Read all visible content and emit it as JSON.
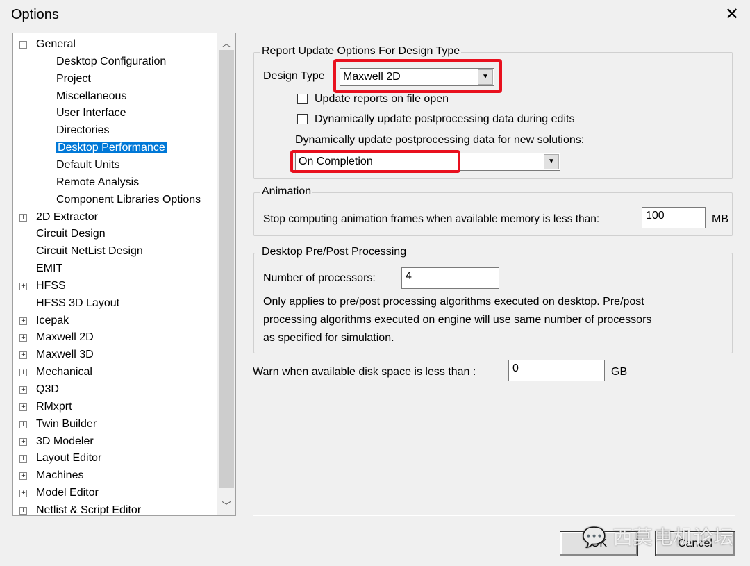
{
  "window": {
    "title": "Options",
    "close_icon": "close-icon"
  },
  "tree": {
    "items": [
      {
        "label": "General",
        "expander": "minus",
        "level": 0,
        "selected": false
      },
      {
        "label": "Desktop Configuration",
        "expander": "",
        "level": 1
      },
      {
        "label": "Project",
        "expander": "",
        "level": 1
      },
      {
        "label": "Miscellaneous",
        "expander": "",
        "level": 1
      },
      {
        "label": "User Interface",
        "expander": "",
        "level": 1
      },
      {
        "label": "Directories",
        "expander": "",
        "level": 1
      },
      {
        "label": "Desktop Performance",
        "expander": "",
        "level": 1,
        "selected": true
      },
      {
        "label": "Default Units",
        "expander": "",
        "level": 1
      },
      {
        "label": "Remote Analysis",
        "expander": "",
        "level": 1
      },
      {
        "label": "Component Libraries Options",
        "expander": "",
        "level": 1
      },
      {
        "label": "2D Extractor",
        "expander": "plus",
        "level": 0
      },
      {
        "label": "Circuit Design",
        "expander": "",
        "level": 0
      },
      {
        "label": "Circuit NetList Design",
        "expander": "",
        "level": 0
      },
      {
        "label": "EMIT",
        "expander": "",
        "level": 0
      },
      {
        "label": "HFSS",
        "expander": "plus",
        "level": 0
      },
      {
        "label": "HFSS 3D Layout",
        "expander": "",
        "level": 0
      },
      {
        "label": "Icepak",
        "expander": "plus",
        "level": 0
      },
      {
        "label": "Maxwell 2D",
        "expander": "plus",
        "level": 0
      },
      {
        "label": "Maxwell 3D",
        "expander": "plus",
        "level": 0
      },
      {
        "label": "Mechanical",
        "expander": "plus",
        "level": 0
      },
      {
        "label": "Q3D",
        "expander": "plus",
        "level": 0
      },
      {
        "label": "RMxprt",
        "expander": "plus",
        "level": 0
      },
      {
        "label": "Twin Builder",
        "expander": "plus",
        "level": 0
      },
      {
        "label": "3D Modeler",
        "expander": "plus",
        "level": 0
      },
      {
        "label": "Layout Editor",
        "expander": "plus",
        "level": 0
      },
      {
        "label": "Machines",
        "expander": "plus",
        "level": 0
      },
      {
        "label": "Model Editor",
        "expander": "plus",
        "level": 0
      },
      {
        "label": "Netlist & Script Editor",
        "expander": "plus",
        "level": 0
      }
    ]
  },
  "report": {
    "group_label": "Report Update Options For Design Type",
    "design_type_label": "Design Type",
    "design_type_value": "Maxwell 2D",
    "check_update_on_open": "Update reports on file open",
    "check_update_on_open_checked": false,
    "check_dynamic_edits": "Dynamically update postprocessing data during edits",
    "check_dynamic_edits_checked": false,
    "new_solutions_label": "Dynamically update postprocessing data for new solutions:",
    "new_solutions_value": "On Completion"
  },
  "animation": {
    "group_label": "Animation",
    "label": "Stop computing animation frames when available memory is less than:",
    "value": "100",
    "unit": "MB"
  },
  "prepost": {
    "group_label": "Desktop Pre/Post Processing",
    "processors_label": "Number of processors:",
    "processors_value": "4",
    "note_lines": [
      "Only applies to pre/post processing algorithms executed on desktop. Pre/post",
      "processing algorithms executed on engine will use same number of processors",
      "as specified for simulation."
    ]
  },
  "disk": {
    "label": "Warn when available disk space is less than :",
    "value": "0",
    "unit": "GB"
  },
  "buttons": {
    "ok": "OK",
    "cancel": "Cancel"
  },
  "watermark": "西莫电机论坛",
  "colors": {
    "highlight": "#e8101e",
    "selection": "#0078d7"
  }
}
